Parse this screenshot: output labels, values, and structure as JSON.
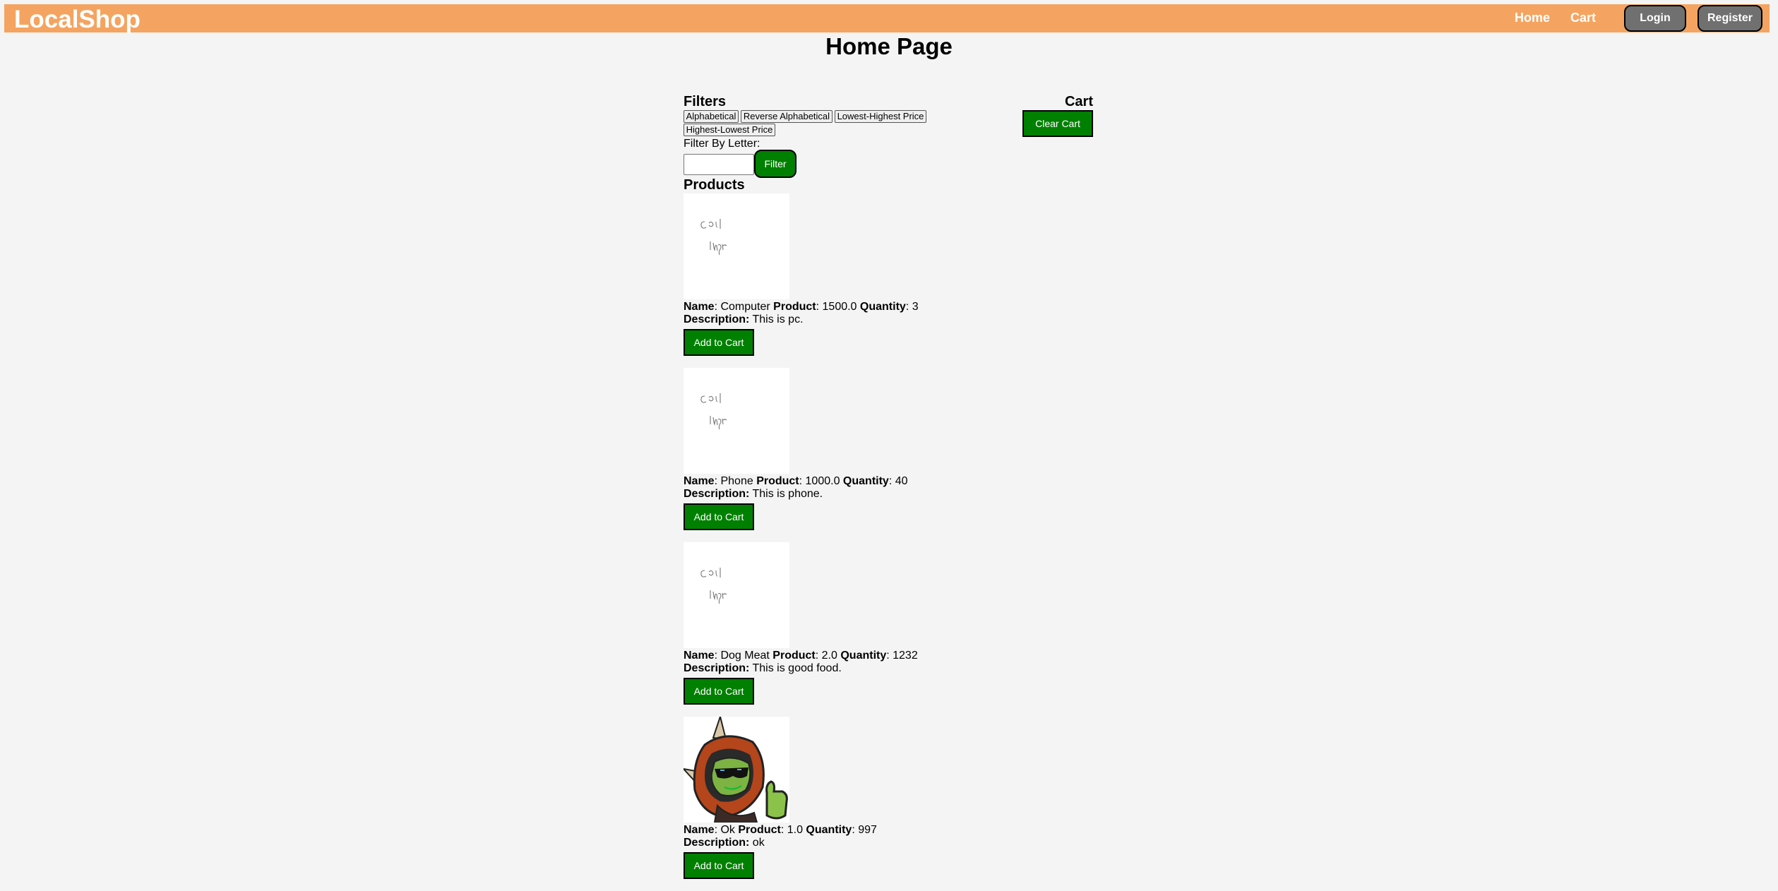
{
  "navbar": {
    "brand": "LocalShop",
    "links": [
      "Home",
      "Cart"
    ],
    "login_label": "Login",
    "register_label": "Register"
  },
  "page_title": "Home Page",
  "filters": {
    "heading": "Filters",
    "sort_buttons": [
      "Alphabetical",
      "Reverse Alphabetical",
      "Lowest-Highest Price",
      "Highest-Lowest Price"
    ],
    "filter_by_letter_label": "Filter By Letter:",
    "letter_input_value": "",
    "filter_button_label": "Filter"
  },
  "cart": {
    "heading": "Cart",
    "clear_label": "Clear Cart"
  },
  "products_heading": "Products",
  "labels": {
    "name": "Name",
    "product": "Product",
    "quantity": "Quantity",
    "description": "Description:",
    "add_to_cart": "Add to Cart"
  },
  "products": [
    {
      "name": "Computer",
      "price": "1500.0",
      "quantity": "3",
      "description": "This is pc.",
      "image": "broken-image-placeholder",
      "image_text": "Cor| Imgr"
    },
    {
      "name": "Phone",
      "price": "1000.0",
      "quantity": "40",
      "description": "This is phone.",
      "image": "broken-image-placeholder",
      "image_text": "Cor| Imgr"
    },
    {
      "name": "Dog Meat",
      "price": "2.0",
      "quantity": "1232",
      "description": "This is good food.",
      "image": "broken-image-placeholder",
      "image_text": "Cor| Imgr"
    },
    {
      "name": "Ok",
      "price": "1.0",
      "quantity": "997",
      "description": "ok",
      "image": "frog-mascot-thumbs-up"
    }
  ],
  "colors": {
    "navbar": "#f4a460",
    "primary_button": "#008000",
    "nav_button": "#707070",
    "background": "#f4f4f4"
  }
}
